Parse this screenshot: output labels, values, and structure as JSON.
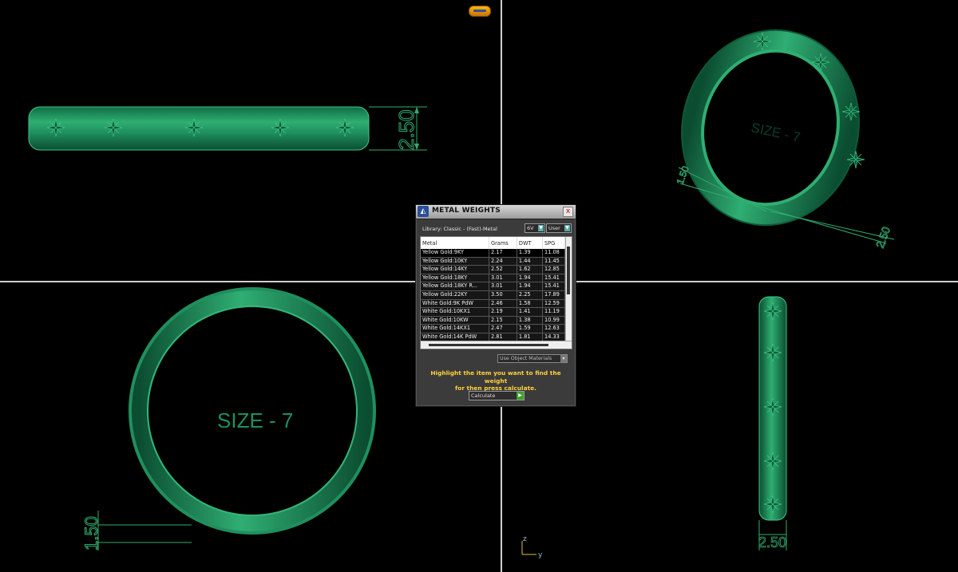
{
  "viewports": {
    "size_label": "SIZE - 7",
    "width_dim": "2.50",
    "thickness_dim": "1.50",
    "axis": {
      "z": "z",
      "y": "y"
    }
  },
  "dialog": {
    "title": "METAL WEIGHTS",
    "close": "x",
    "library": "Library: Classic - (Fast)-Metal",
    "unit_primary": "6V",
    "unit_secondary": "User",
    "columns": [
      "Metal",
      "Grams",
      "DWT",
      "SPG"
    ],
    "rows": [
      {
        "metal": "Yellow Gold:9KY",
        "grams": "2.17",
        "dwt": "1.39",
        "spg": "11.08"
      },
      {
        "metal": "Yellow Gold:10KY",
        "grams": "2.24",
        "dwt": "1.44",
        "spg": "11.45"
      },
      {
        "metal": "Yellow Gold:14KY",
        "grams": "2.52",
        "dwt": "1.62",
        "spg": "12.85"
      },
      {
        "metal": "Yellow Gold:18KY",
        "grams": "3.01",
        "dwt": "1.94",
        "spg": "15.41"
      },
      {
        "metal": "Yellow Gold:18KY R...",
        "grams": "3.01",
        "dwt": "1.94",
        "spg": "15.41"
      },
      {
        "metal": "Yellow Gold:22KY",
        "grams": "3.50",
        "dwt": "2.25",
        "spg": "17.89"
      },
      {
        "metal": "White Gold:9K PdW",
        "grams": "2.46",
        "dwt": "1.58",
        "spg": "12.59"
      },
      {
        "metal": "White Gold:10KX1",
        "grams": "2.19",
        "dwt": "1.41",
        "spg": "11.19"
      },
      {
        "metal": "White Gold:10KW",
        "grams": "2.15",
        "dwt": "1.38",
        "spg": "10.99"
      },
      {
        "metal": "White Gold:14KX1",
        "grams": "2.47",
        "dwt": "1.59",
        "spg": "12.63"
      },
      {
        "metal": "White Gold:14K PdW",
        "grams": "2.81",
        "dwt": "1.81",
        "spg": "14.33"
      }
    ],
    "use_object_materials": "Use Object Materials",
    "hint_line1": "Highlight the item you want to find the weight",
    "hint_line2": "for then press calculate.",
    "calculate": "Calculate"
  },
  "colors": {
    "ring": "#1f8f5e",
    "ring_light": "#34b67a",
    "ring_dark": "#0d5a38",
    "dim": "#2fae6e",
    "hint": "#ffd23a"
  }
}
